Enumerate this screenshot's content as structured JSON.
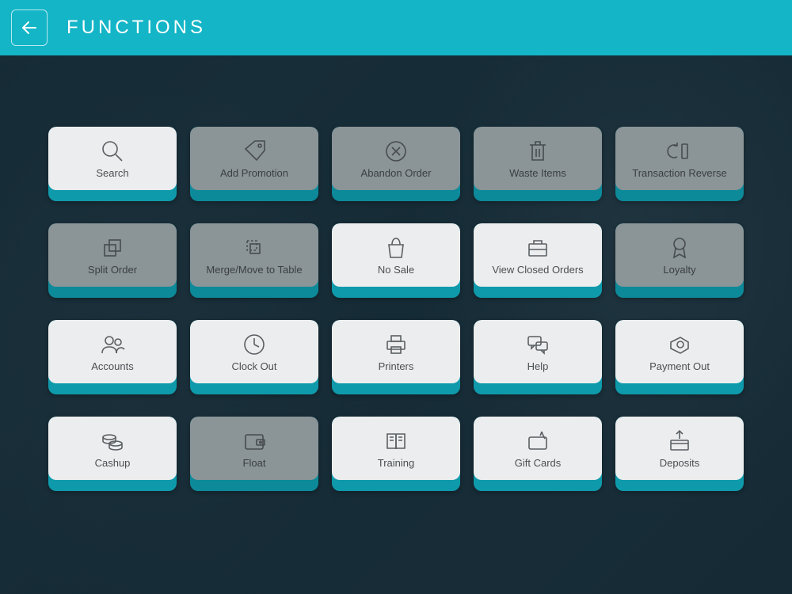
{
  "header": {
    "title": "FUNCTIONS"
  },
  "tiles": [
    {
      "id": "search",
      "label": "Search",
      "enabled": true,
      "icon": "search-icon"
    },
    {
      "id": "add-promotion",
      "label": "Add Promotion",
      "enabled": false,
      "icon": "tag-icon"
    },
    {
      "id": "abandon-order",
      "label": "Abandon Order",
      "enabled": false,
      "icon": "circle-x-icon"
    },
    {
      "id": "waste-items",
      "label": "Waste Items",
      "enabled": false,
      "icon": "trash-icon"
    },
    {
      "id": "transaction-reverse",
      "label": "Transaction Reverse",
      "enabled": false,
      "icon": "reverse-icon"
    },
    {
      "id": "split-order",
      "label": "Split Order",
      "enabled": false,
      "icon": "split-icon"
    },
    {
      "id": "merge-move",
      "label": "Merge/Move to Table",
      "enabled": false,
      "icon": "merge-icon"
    },
    {
      "id": "no-sale",
      "label": "No Sale",
      "enabled": true,
      "icon": "bag-icon"
    },
    {
      "id": "view-closed-orders",
      "label": "View Closed Orders",
      "enabled": true,
      "icon": "briefcase-icon"
    },
    {
      "id": "loyalty",
      "label": "Loyalty",
      "enabled": false,
      "icon": "ribbon-icon"
    },
    {
      "id": "accounts",
      "label": "Accounts",
      "enabled": true,
      "icon": "people-icon"
    },
    {
      "id": "clock-out",
      "label": "Clock Out",
      "enabled": true,
      "icon": "clock-icon"
    },
    {
      "id": "printers",
      "label": "Printers",
      "enabled": true,
      "icon": "printer-icon"
    },
    {
      "id": "help",
      "label": "Help",
      "enabled": true,
      "icon": "chat-icon"
    },
    {
      "id": "payment-out",
      "label": "Payment Out",
      "enabled": true,
      "icon": "payment-icon"
    },
    {
      "id": "cashup",
      "label": "Cashup",
      "enabled": true,
      "icon": "coins-icon"
    },
    {
      "id": "float",
      "label": "Float",
      "enabled": false,
      "icon": "wallet-icon"
    },
    {
      "id": "training",
      "label": "Training",
      "enabled": true,
      "icon": "book-icon"
    },
    {
      "id": "gift-cards",
      "label": "Gift Cards",
      "enabled": true,
      "icon": "giftcard-icon"
    },
    {
      "id": "deposits",
      "label": "Deposits",
      "enabled": true,
      "icon": "deposit-icon"
    }
  ]
}
